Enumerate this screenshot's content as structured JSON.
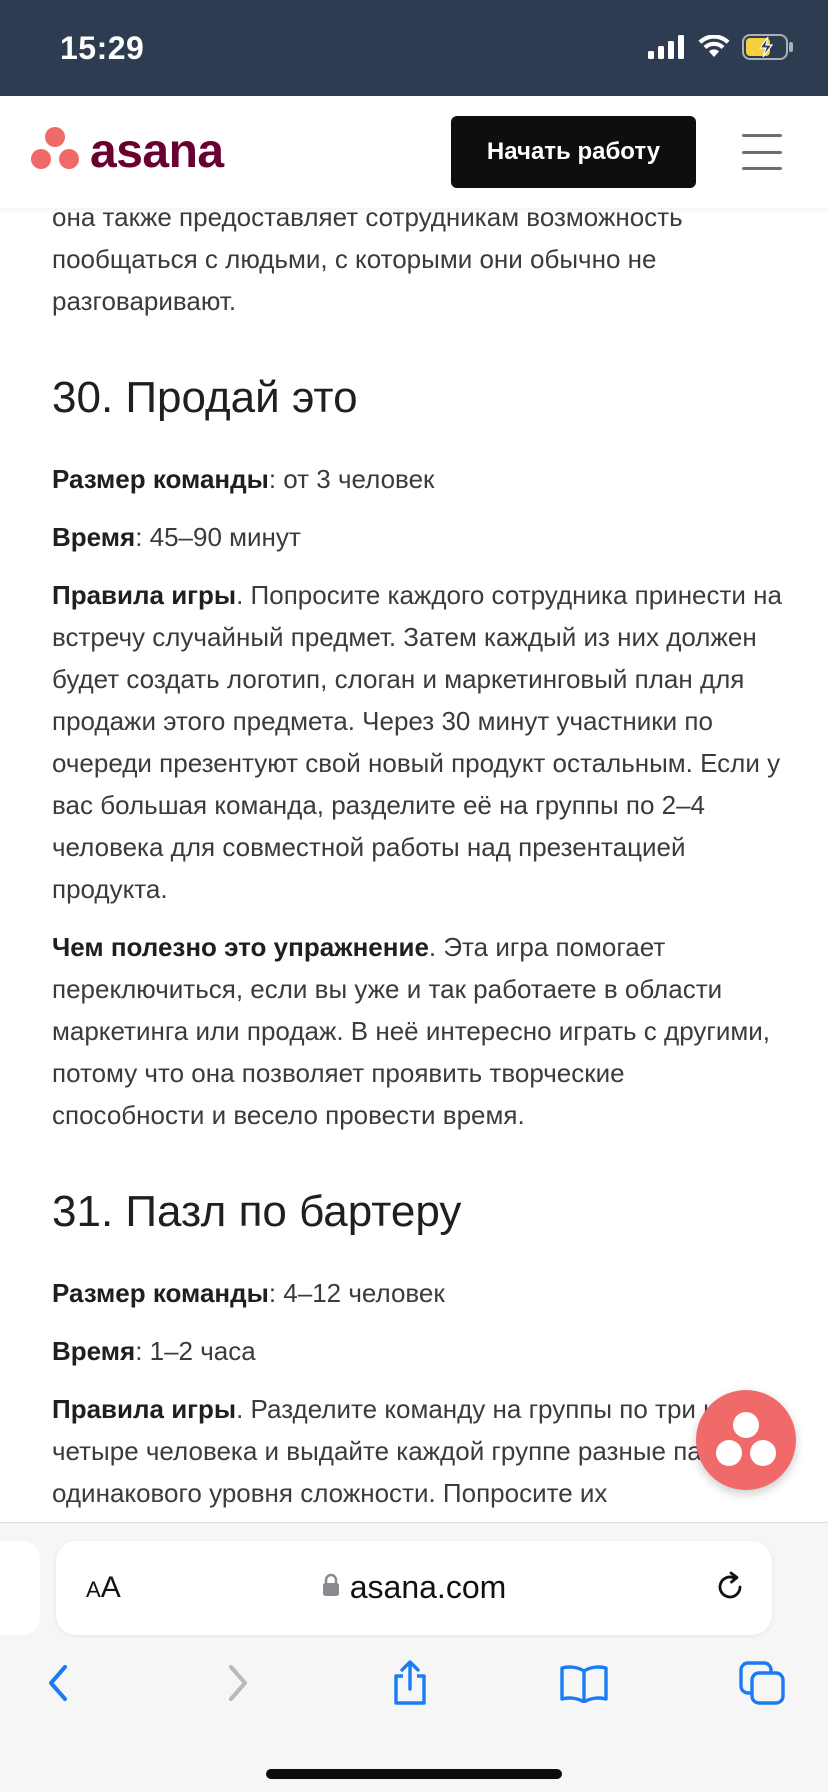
{
  "status_bar": {
    "time": "15:29"
  },
  "header": {
    "logo_text": "asana",
    "cta_label": "Начать работу"
  },
  "colors": {
    "brand": "#690031",
    "coral": "#f06a6a",
    "status_bar": "#2e3c51"
  },
  "article": {
    "intro_text": "она также предоставляет сотрудникам возможность пообщаться с людьми, с которыми они обычно не разговаривают.",
    "section30": {
      "title": "30. Продай это",
      "team_size_label": "Размер команды",
      "team_size_value": ": от 3 человек",
      "time_label": "Время",
      "time_value": ": 45–90 минут",
      "rules_label": "Правила игры",
      "rules_text": ". Попросите каждого сотрудника принести на встречу случайный предмет. Затем каждый из них должен будет создать логотип, слоган и маркетинговый план для продажи этого предмета. Через 30 минут участники по очереди презентуют свой новый продукт остальным. Если у вас большая команда, разделите её на группы по 2–4 человека для совместной работы над презентацией продукта.",
      "benefit_label": "Чем полезно это упражнение",
      "benefit_text": ". Эта игра помогает переключиться, если вы уже и так работаете в области маркетинга или продаж. В неё интересно играть с другими, потому что она позволяет проявить творческие способности и весело провести время."
    },
    "section31": {
      "title": "31. Пазл по бартеру",
      "team_size_label": "Размер команды",
      "team_size_value": ": 4–12 человек",
      "time_label": "Время",
      "time_value": ": 1–2 часа",
      "rules_label": "Правила игры",
      "rules_text": ". Разделите команду на группы по три или четыре человека и выдайте каждой группе разные пазлы одинакового уровня сложности. Попросите их"
    }
  },
  "browser": {
    "text_size_label_small": "A",
    "text_size_label_large": "A",
    "url": "asana.com"
  },
  "icons": {
    "signal": "signal-icon",
    "wifi": "wifi-icon",
    "battery": "battery-charging-icon",
    "menu": "hamburger-menu-icon",
    "lock": "lock-icon",
    "reload": "reload-icon",
    "back": "chevron-left-icon",
    "forward": "chevron-right-icon",
    "share": "share-icon",
    "bookmarks": "book-icon",
    "tabs": "tabs-icon"
  }
}
